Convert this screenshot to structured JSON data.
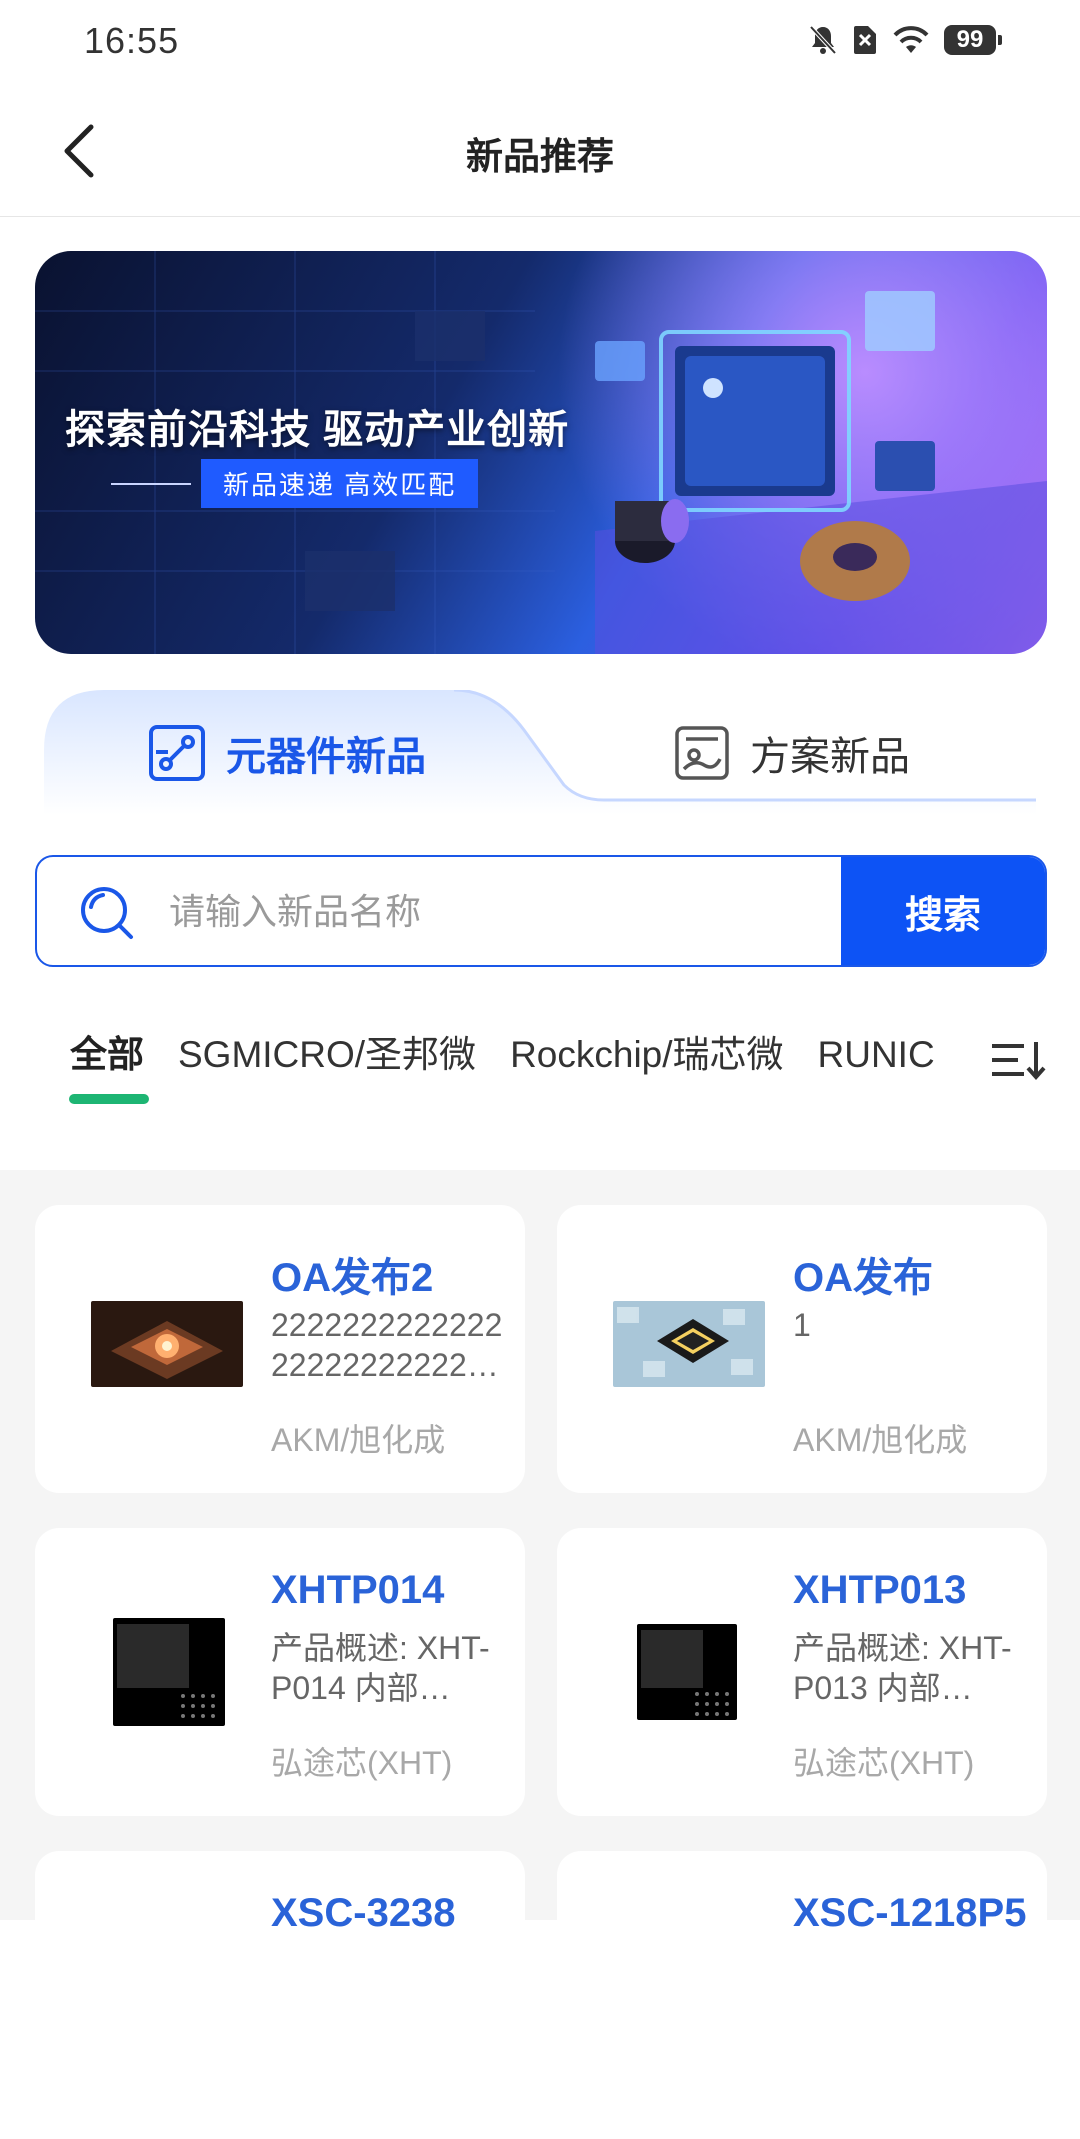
{
  "status_bar": {
    "time": "16:55",
    "battery": "99"
  },
  "nav": {
    "title": "新品推荐"
  },
  "banner": {
    "headline": "探索前沿科技 驱动产业创新",
    "subline": "新品速递 高效匹配"
  },
  "tabs": [
    {
      "label": "元器件新品",
      "active": true
    },
    {
      "label": "方案新品",
      "active": false
    }
  ],
  "search": {
    "placeholder": "请输入新品名称",
    "value": "",
    "button_label": "搜索"
  },
  "filters": [
    "全部",
    "SGMICRO/圣邦微",
    "Rockchip/瑞芯微",
    "RUNIC"
  ],
  "products": [
    {
      "title": "OA发布2",
      "desc": "222222222222222222222222…",
      "brand": "AKM/旭化成"
    },
    {
      "title": "OA发布",
      "desc": "1",
      "brand": "AKM/旭化成"
    },
    {
      "title": "XHTP014",
      "desc": "产品概述: XHT-P014 内部…",
      "brand": "弘途芯(XHT)"
    },
    {
      "title": "XHTP013",
      "desc": "产品概述: XHT-P013 内部…",
      "brand": "弘途芯(XHT)"
    },
    {
      "title": "XSC-3238",
      "desc": "",
      "brand": ""
    },
    {
      "title": "XSC-1218P5",
      "desc": "",
      "brand": ""
    }
  ],
  "colors": {
    "accent": "#1a57e8",
    "filter_indicator": "#1db573",
    "title_blue": "#2a63d8"
  }
}
